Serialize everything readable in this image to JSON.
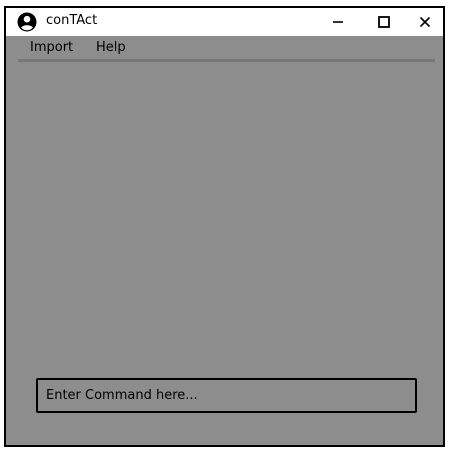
{
  "window": {
    "title": "conTAct",
    "icon": "user-circle-icon",
    "controls": {
      "minimize": "minimize-icon",
      "maximize": "maximize-icon",
      "close": "close-icon"
    }
  },
  "menu": {
    "items": [
      {
        "label": "Import"
      },
      {
        "label": "Help"
      }
    ]
  },
  "command": {
    "placeholder": "Enter Command here..."
  },
  "colors": {
    "background": "#8d8d8d",
    "titlebar": "#ffffff",
    "separator": "#777777",
    "border": "#000000"
  }
}
